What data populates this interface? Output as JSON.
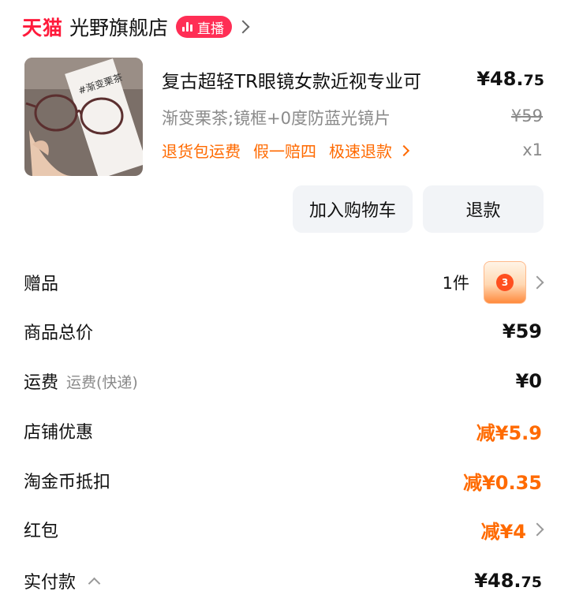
{
  "header": {
    "brand": "天猫",
    "store_name": "光野旗舰店",
    "live_badge": "直播"
  },
  "product": {
    "title": "复古超轻TR眼镜女款近视专业可",
    "price_int": "¥48.",
    "price_dec": "75",
    "sku": "渐变栗茶;镜框+0度防蓝光镜片",
    "original_price": "¥59",
    "services": [
      "退货包运费",
      "假一赔四",
      "极速退款"
    ],
    "quantity": "x1",
    "image_text": "#渐变栗茶"
  },
  "buttons": {
    "add_to_cart": "加入购物车",
    "refund": "退款"
  },
  "summary": {
    "gift_label": "赠品",
    "gift_count": "1件",
    "gift_thumb_text": "3",
    "total_label": "商品总价",
    "total_value": "¥59",
    "shipping_label": "运费",
    "shipping_sub": "运费(快递)",
    "shipping_value": "¥0",
    "store_discount_label": "店铺优惠",
    "store_discount_value": "减¥5.9",
    "coin_label": "淘金币抵扣",
    "coin_value": "减¥0.35",
    "redpacket_label": "红包",
    "redpacket_value": "减¥4",
    "paid_label": "实付款",
    "paid_int": "¥48.",
    "paid_dec": "75"
  },
  "colors": {
    "brand_red": "#ff1a3b",
    "live_pink": "#ff2e55",
    "discount_orange": "#ff6a00",
    "muted_gray": "#8a8a8a",
    "button_bg": "#f2f4f7"
  }
}
